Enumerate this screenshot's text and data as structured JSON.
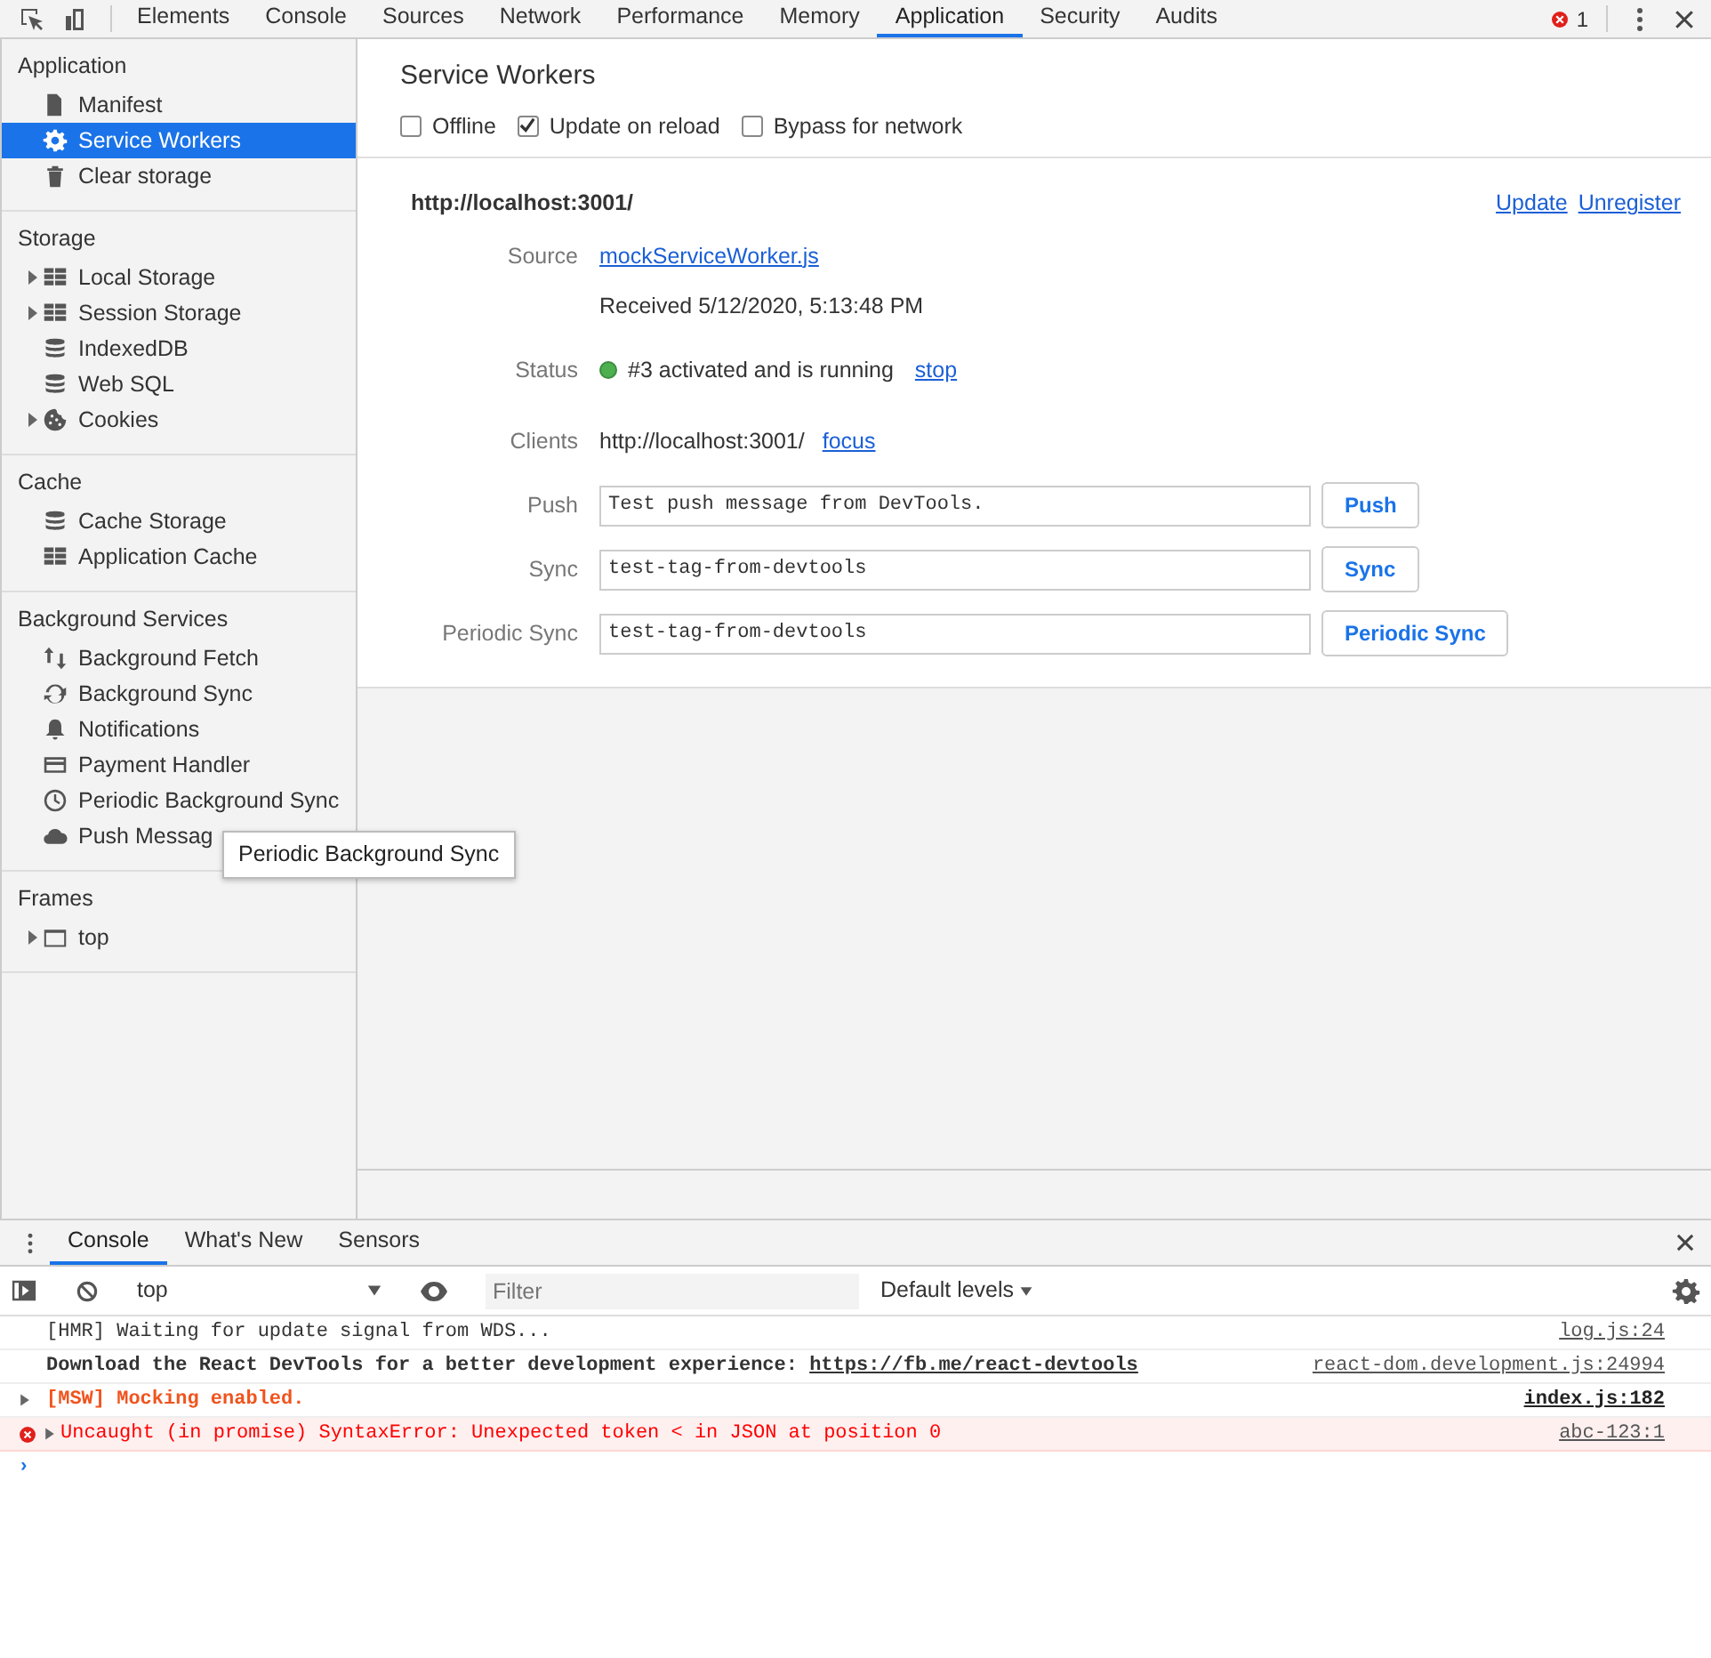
{
  "toolbar": {
    "tabs": [
      {
        "label": "Elements",
        "selected": false
      },
      {
        "label": "Console",
        "selected": false
      },
      {
        "label": "Sources",
        "selected": false
      },
      {
        "label": "Network",
        "selected": false
      },
      {
        "label": "Performance",
        "selected": false
      },
      {
        "label": "Memory",
        "selected": false
      },
      {
        "label": "Application",
        "selected": true
      },
      {
        "label": "Security",
        "selected": false
      },
      {
        "label": "Audits",
        "selected": false
      }
    ],
    "error_count": "1"
  },
  "sidebar": {
    "sections": [
      {
        "title": "Application",
        "items": [
          {
            "label": "Manifest",
            "expandable": false,
            "selected": false
          },
          {
            "label": "Service Workers",
            "expandable": false,
            "selected": true
          },
          {
            "label": "Clear storage",
            "expandable": false,
            "selected": false
          }
        ]
      },
      {
        "title": "Storage",
        "items": [
          {
            "label": "Local Storage",
            "expandable": true,
            "selected": false
          },
          {
            "label": "Session Storage",
            "expandable": true,
            "selected": false
          },
          {
            "label": "IndexedDB",
            "expandable": false,
            "selected": false
          },
          {
            "label": "Web SQL",
            "expandable": false,
            "selected": false
          },
          {
            "label": "Cookies",
            "expandable": true,
            "selected": false
          }
        ]
      },
      {
        "title": "Cache",
        "items": [
          {
            "label": "Cache Storage",
            "expandable": false,
            "selected": false
          },
          {
            "label": "Application Cache",
            "expandable": false,
            "selected": false
          }
        ]
      },
      {
        "title": "Background Services",
        "items": [
          {
            "label": "Background Fetch",
            "expandable": false,
            "selected": false
          },
          {
            "label": "Background Sync",
            "expandable": false,
            "selected": false
          },
          {
            "label": "Notifications",
            "expandable": false,
            "selected": false
          },
          {
            "label": "Payment Handler",
            "expandable": false,
            "selected": false
          },
          {
            "label": "Periodic Background Sync",
            "expandable": false,
            "selected": false
          },
          {
            "label": "Push Messag",
            "expandable": false,
            "selected": false
          }
        ]
      },
      {
        "title": "Frames",
        "items": [
          {
            "label": "top",
            "expandable": true,
            "selected": false
          }
        ]
      }
    ],
    "tooltip": "Periodic Background Sync"
  },
  "main": {
    "title": "Service Workers",
    "options": [
      {
        "label": "Offline",
        "checked": false
      },
      {
        "label": "Update on reload",
        "checked": true
      },
      {
        "label": "Bypass for network",
        "checked": false
      }
    ],
    "worker": {
      "scope": "http://localhost:3001/",
      "actions": [
        "Update",
        "Unregister"
      ],
      "source_label": "Source",
      "source": "mockServiceWorker.js",
      "received": "Received 5/12/2020, 5:13:48 PM",
      "status_label": "Status",
      "status": "#3 activated and is running",
      "status_action": "stop",
      "clients_label": "Clients",
      "client": "http://localhost:3001/",
      "client_action": "focus",
      "triggers": [
        {
          "label": "Push",
          "value": "Test push message from DevTools.",
          "button": "Push"
        },
        {
          "label": "Sync",
          "value": "test-tag-from-devtools",
          "button": "Sync"
        },
        {
          "label": "Periodic Sync",
          "value": "test-tag-from-devtools",
          "button": "Periodic Sync"
        }
      ]
    }
  },
  "drawer": {
    "tabs": [
      {
        "label": "Console",
        "selected": true
      },
      {
        "label": "What's New",
        "selected": false
      },
      {
        "label": "Sensors",
        "selected": false
      }
    ],
    "context": "top",
    "filter_placeholder": "Filter",
    "levels": "Default levels",
    "messages": [
      {
        "kind": "log",
        "expandable": false,
        "text": "[HMR] Waiting for update signal from WDS...",
        "source": "log.js:24"
      },
      {
        "kind": "bold",
        "expandable": false,
        "text": "Download the React DevTools for a better development experience: ",
        "link": "https://fb.me/react-devtools",
        "source": "react-dom.development.js:24994"
      },
      {
        "kind": "styled",
        "expandable": true,
        "text": "[MSW] Mocking enabled.",
        "source": "index.js:182"
      },
      {
        "kind": "error",
        "expandable": true,
        "text": "Uncaught (in promise) SyntaxError: Unexpected token < in JSON at position 0",
        "source": "abc-123:1"
      }
    ],
    "prompt": "›"
  }
}
